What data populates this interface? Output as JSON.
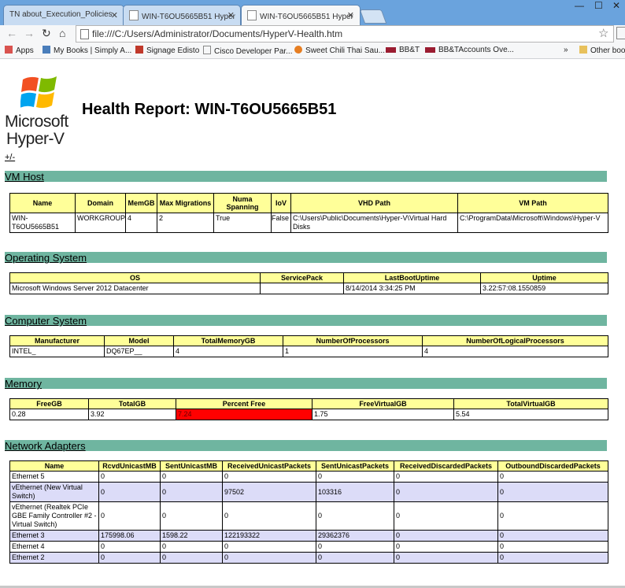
{
  "browser": {
    "tabs": [
      {
        "label": "TN about_Execution_Policies"
      },
      {
        "label": "WIN-T6OU5665B51 Hyper"
      },
      {
        "label": "WIN-T6OU5665B51 Hyper"
      }
    ],
    "address": "file:///C:/Users/Administrator/Documents/HyperV-Health.htm",
    "bookmarks": [
      {
        "label": "Apps",
        "color": "#d9534f"
      },
      {
        "label": "My Books | Simply A...",
        "color": "#4a7ebb"
      },
      {
        "label": "Signage Edisto",
        "color": "#c0392b"
      },
      {
        "label": "Cisco Developer Par...",
        "color": "#888888"
      },
      {
        "label": "Sweet Chili Thai Sau...",
        "color": "#e67e22"
      },
      {
        "label": "BB&T",
        "color": "#9b1c31"
      },
      {
        "label": "BB&TAccounts Ove...",
        "color": "#9b1c31"
      }
    ],
    "more_label": "»",
    "other_bookmarks": "Other boo"
  },
  "page": {
    "logo_line1": "Microsoft",
    "logo_line2": "Hyper-V",
    "title": "Health Report: WIN-T6OU5665B51",
    "toggle": "+/-"
  },
  "sections": {
    "vmhost": {
      "title": "VM Host",
      "headers": [
        "Name",
        "Domain",
        "MemGB",
        "Max Migrations",
        "Numa Spanning",
        "IoV",
        "VHD Path",
        "VM Path"
      ],
      "rows": [
        [
          "WIN-T6OU5665B51",
          "WORKGROUP",
          "4",
          "2",
          "True",
          "False",
          "C:\\Users\\Public\\Documents\\Hyper-V\\Virtual Hard Disks",
          "C:\\ProgramData\\Microsoft\\Windows\\Hyper-V"
        ]
      ]
    },
    "os": {
      "title": "Operating System",
      "headers": [
        "OS",
        "ServicePack",
        "LastBootUptime",
        "Uptime"
      ],
      "rows": [
        [
          "Microsoft Windows Server 2012 Datacenter",
          "",
          "8/14/2014 3:34:25 PM",
          "3.22:57:08.1550859"
        ]
      ]
    },
    "computer": {
      "title": "Computer System",
      "headers": [
        "Manufacturer",
        "Model",
        "TotalMemoryGB",
        "NumberOfProcessors",
        "NumberOfLogicalProcessors"
      ],
      "rows": [
        [
          "INTEL_",
          "DQ67EP__",
          "4",
          "1",
          "4"
        ]
      ]
    },
    "memory": {
      "title": "Memory",
      "headers": [
        "FreeGB",
        "TotalGB",
        "Percent Free",
        "FreeVirtualGB",
        "TotalVirtualGB"
      ],
      "rows": [
        [
          "0.28",
          "3.92",
          "7.24",
          "1.75",
          "5.54"
        ]
      ],
      "alert_color": "#ff0000"
    },
    "network": {
      "title": "Network Adapters",
      "headers": [
        "Name",
        "RcvdUnicastMB",
        "SentUnicastMB",
        "ReceivedUnicastPackets",
        "SentUnicastPackets",
        "ReceivedDiscardedPackets",
        "OutboundDiscardedPackets"
      ],
      "rows": [
        [
          "Ethernet 5",
          "0",
          "0",
          "0",
          "0",
          "0",
          "0"
        ],
        [
          "vEthernet (New Virtual Switch)",
          "0",
          "0",
          "97502",
          "103316",
          "0",
          "0"
        ],
        [
          "vEthernet (Realtek PCIe GBE Family Controller #2 - Virtual Switch)",
          "0",
          "0",
          "0",
          "0",
          "0",
          "0"
        ],
        [
          "Ethernet 3",
          "175998.06",
          "1598.22",
          "122193322",
          "29362376",
          "0",
          "0"
        ],
        [
          "Ethernet 4",
          "0",
          "0",
          "0",
          "0",
          "0",
          "0"
        ],
        [
          "Ethernet 2",
          "0",
          "0",
          "0",
          "0",
          "0",
          "0"
        ]
      ]
    }
  }
}
